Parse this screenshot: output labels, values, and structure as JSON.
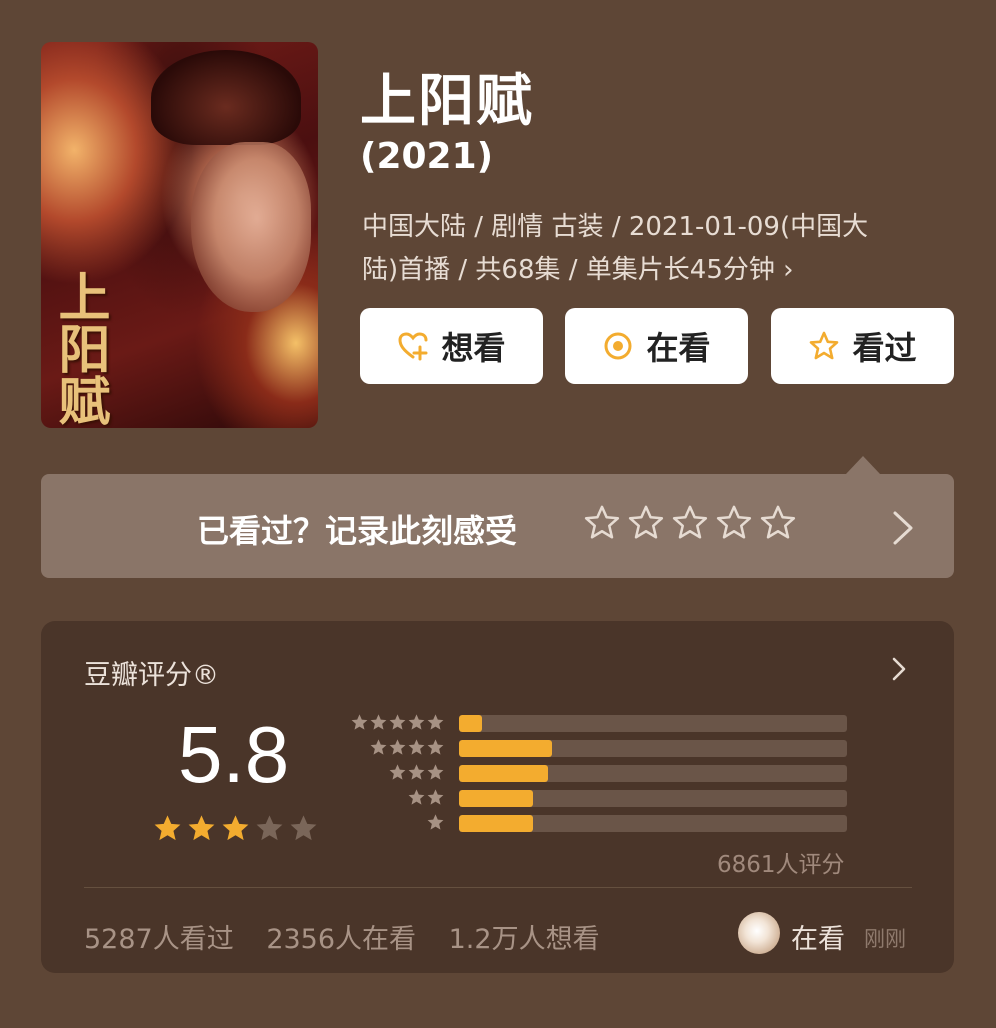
{
  "title": "上阳赋",
  "year": "(2021)",
  "poster": {
    "title_art": "上阳赋"
  },
  "meta": {
    "line1": "中国大陆 / 剧情 古装 / 2021-01-09(中国大",
    "line2": "陆)首播 / 共68集 / 单集片长45分钟",
    "chevron": "›"
  },
  "actions": {
    "want_label": "想看",
    "watching_label": "在看",
    "watched_label": "看过",
    "accent": "#f3ac2f"
  },
  "record": {
    "prompt": "已看过？记录此刻感受",
    "star_count": 5
  },
  "rating": {
    "label": "豆瓣评分®",
    "score": "5.8",
    "stars_filled": 3,
    "stars_total": 5,
    "distribution_percent": [
      6,
      24,
      23,
      19,
      19
    ],
    "count_text": "6861人评分",
    "stats": {
      "watched": "5287人看过",
      "watching": "2356人在看",
      "want": "1.2万人想看"
    },
    "activity": {
      "status": "在看",
      "time": "刚刚"
    },
    "colors": {
      "bar_fill": "#f3ac2f",
      "bar_track": "#6a5548",
      "star_on": "#f3ac2f",
      "star_off": "#7a6659"
    }
  }
}
